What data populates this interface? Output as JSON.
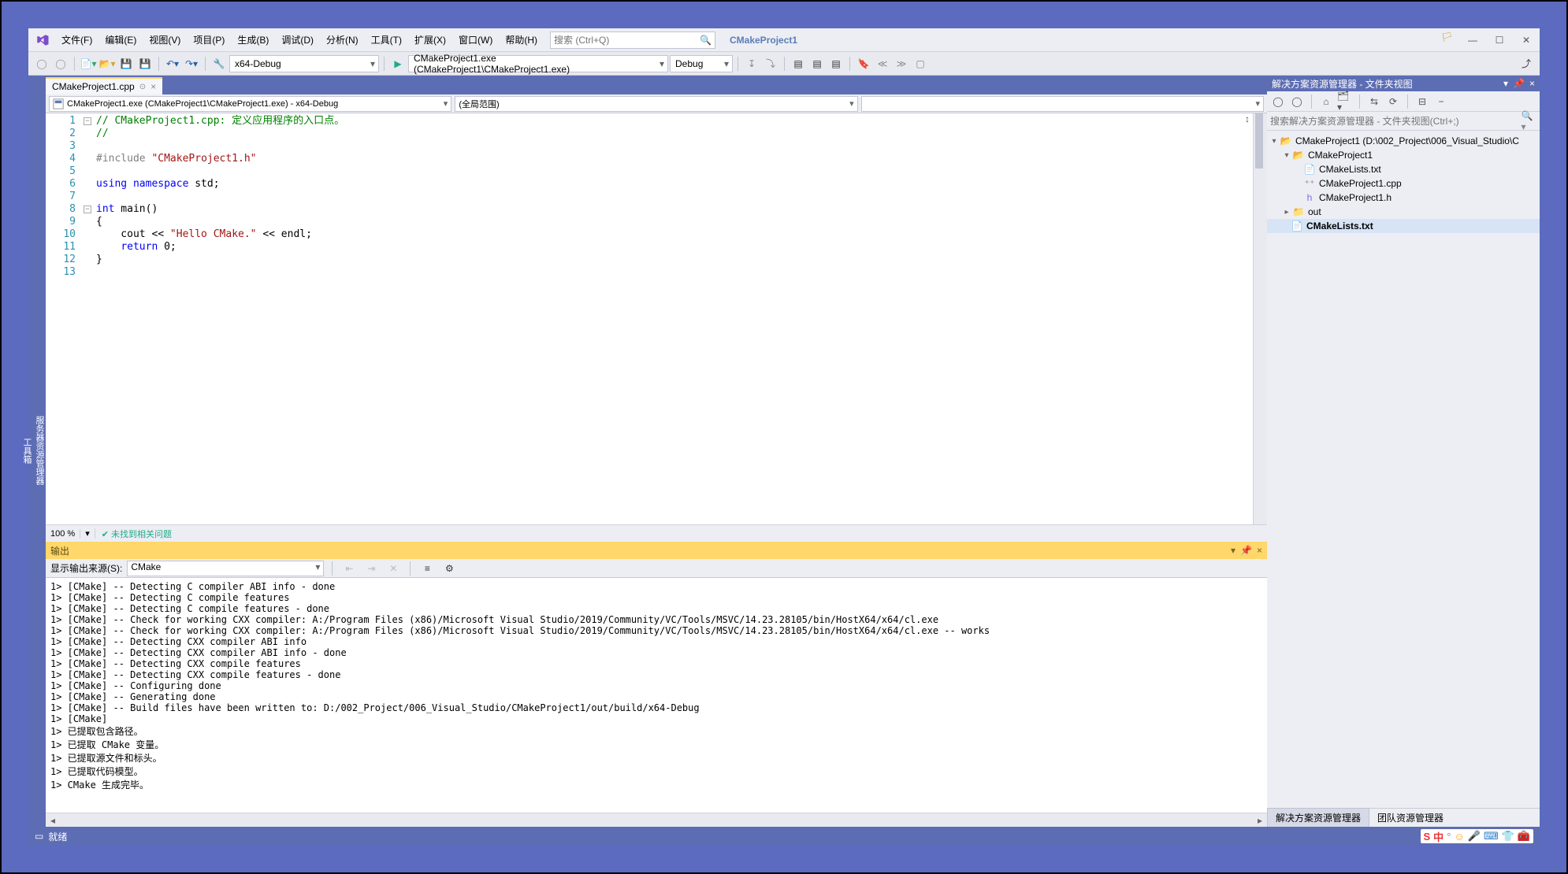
{
  "menubar": {
    "file": "文件(F)",
    "edit": "编辑(E)",
    "view": "视图(V)",
    "project": "项目(P)",
    "build": "生成(B)",
    "debug": "调试(D)",
    "analyze": "分析(N)",
    "tools": "工具(T)",
    "extensions": "扩展(X)",
    "window": "窗口(W)",
    "help": "帮助(H)"
  },
  "search": {
    "placeholder": "搜索 (Ctrl+Q)"
  },
  "project_title": "CMakeProject1",
  "toolbar": {
    "config": "x64-Debug",
    "start_label": "CMakeProject1.exe (CMakeProject1\\CMakeProject1.exe)",
    "debug_label": "Debug"
  },
  "editor": {
    "tab_name": "CMakeProject1.cpp",
    "nav_left": "CMakeProject1.exe (CMakeProject1\\CMakeProject1.exe) - x64-Debug",
    "nav_right": "(全局范围)",
    "zoom": "100 %",
    "issues": "未找到相关问题",
    "lines": {
      "l1_comment": "// CMakeProject1.cpp: 定义应用程序的入口点。",
      "l2": "//",
      "l4_a": "#include ",
      "l4_b": "\"CMakeProject1.h\"",
      "l6_a": "using",
      "l6_b": " namespace ",
      "l6_c": "std",
      "l6_d": ";",
      "l8_a": "int",
      "l8_b": " main()",
      "l9": "{",
      "l10_a": "    cout << ",
      "l10_b": "\"Hello CMake.\"",
      "l10_c": " << endl;",
      "l11_a": "    ",
      "l11_b": "return",
      "l11_c": " 0;",
      "l12": "}"
    }
  },
  "output": {
    "title": "输出",
    "source_label": "显示输出来源(S):",
    "source_value": "CMake",
    "body": "1> [CMake] -- Detecting C compiler ABI info - done\n1> [CMake] -- Detecting C compile features\n1> [CMake] -- Detecting C compile features - done\n1> [CMake] -- Check for working CXX compiler: A:/Program Files (x86)/Microsoft Visual Studio/2019/Community/VC/Tools/MSVC/14.23.28105/bin/HostX64/x64/cl.exe\n1> [CMake] -- Check for working CXX compiler: A:/Program Files (x86)/Microsoft Visual Studio/2019/Community/VC/Tools/MSVC/14.23.28105/bin/HostX64/x64/cl.exe -- works\n1> [CMake] -- Detecting CXX compiler ABI info\n1> [CMake] -- Detecting CXX compiler ABI info - done\n1> [CMake] -- Detecting CXX compile features\n1> [CMake] -- Detecting CXX compile features - done\n1> [CMake] -- Configuring done\n1> [CMake] -- Generating done\n1> [CMake] -- Build files have been written to: D:/002_Project/006_Visual_Studio/CMakeProject1/out/build/x64-Debug\n1> [CMake] \n1> 已提取包含路径。\n1> 已提取 CMake 变量。\n1> 已提取源文件和标头。\n1> 已提取代码模型。\n1> CMake 生成完毕。"
  },
  "solution": {
    "title": "解决方案资源管理器 - 文件夹视图",
    "search_placeholder": "搜索解决方案资源管理器 - 文件夹视图(Ctrl+;)",
    "root": "CMakeProject1 (D:\\002_Project\\006_Visual_Studio\\C",
    "folder1": "CMakeProject1",
    "items": {
      "a": "CMakeLists.txt",
      "b": "CMakeProject1.cpp",
      "c": "CMakeProject1.h"
    },
    "folder2": "out",
    "rootfile": "CMakeLists.txt",
    "tabs": {
      "a": "解决方案资源管理器",
      "b": "团队资源管理器"
    }
  },
  "left_tabs": {
    "a": "服务器资源管理器",
    "b": "工具箱"
  },
  "statusbar": {
    "ready": "就绪"
  },
  "tray_chars": {
    "s": "S",
    "zh": "中"
  }
}
